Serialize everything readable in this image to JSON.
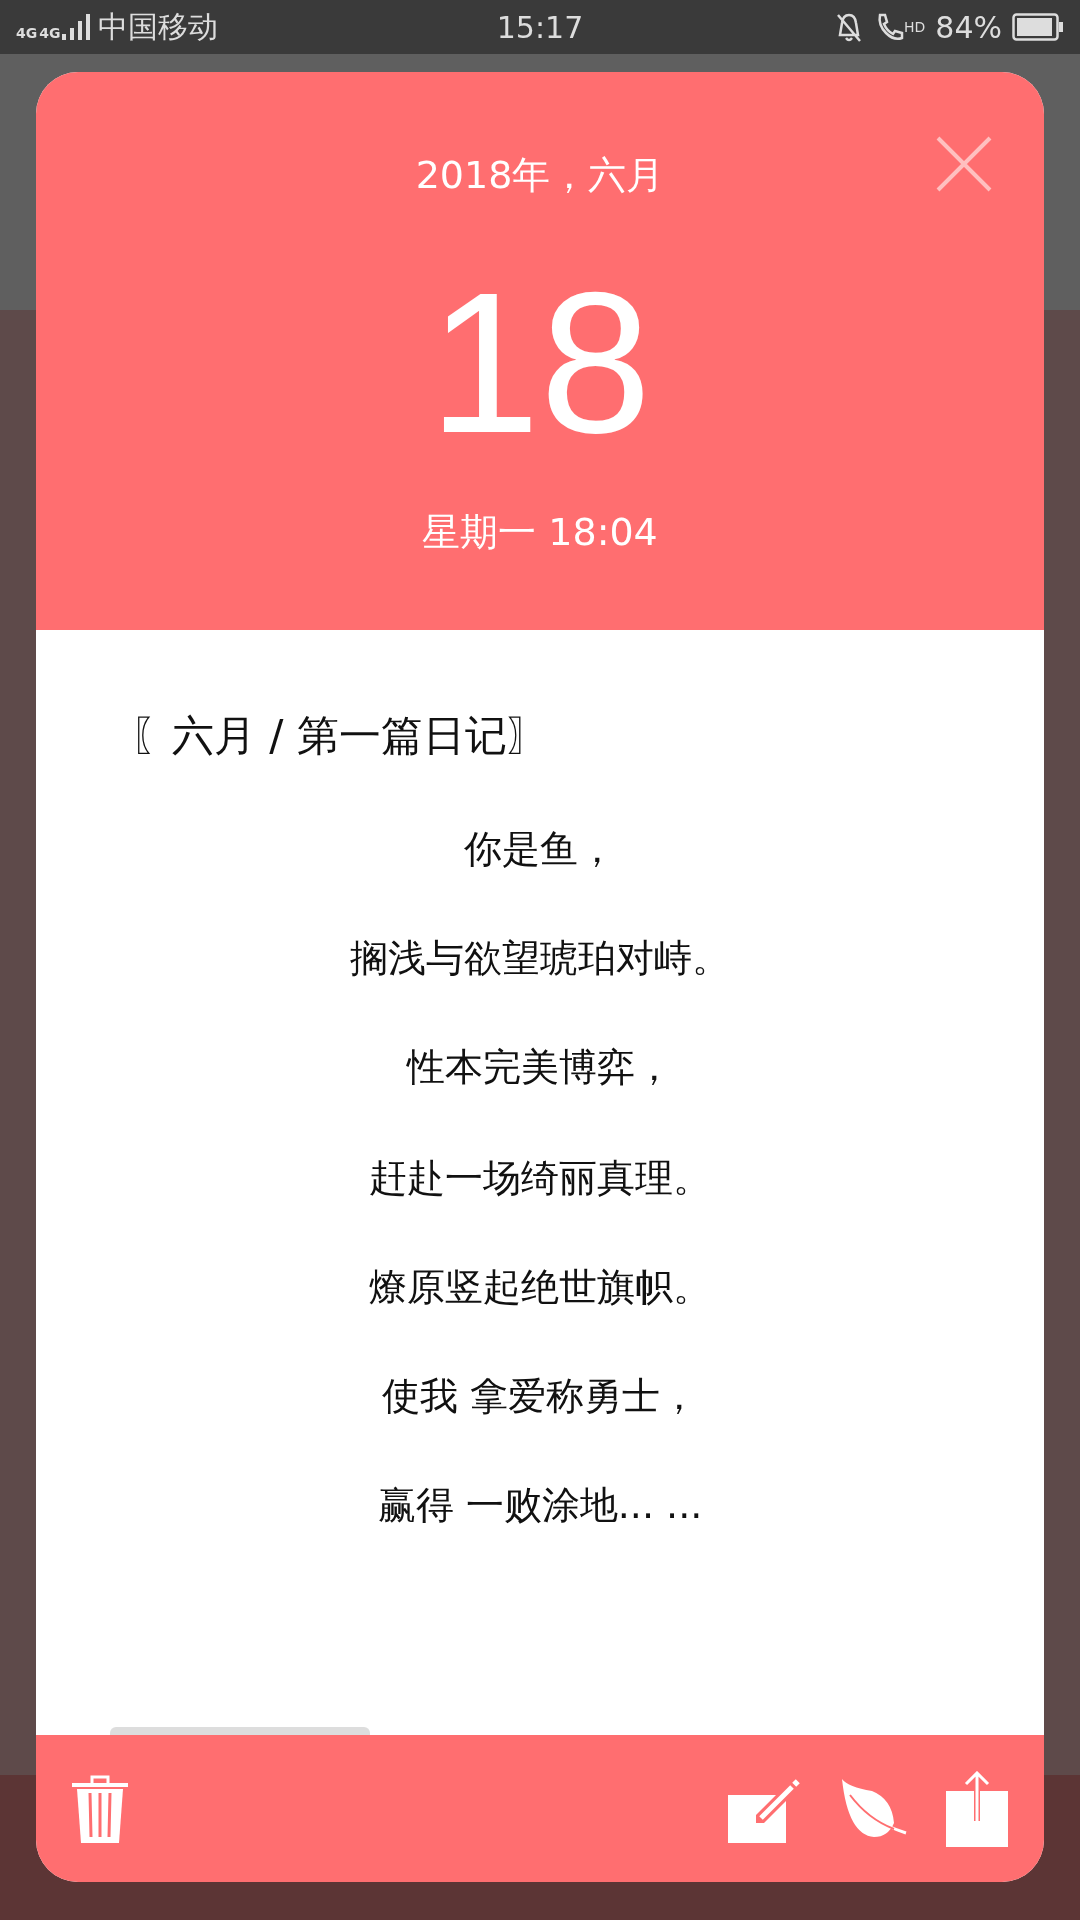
{
  "status_bar": {
    "network": [
      "4G",
      "4G"
    ],
    "carrier": "中国移动",
    "time": "15:17",
    "hd": "HD",
    "battery": "84%"
  },
  "header": {
    "year_month": "2018年，六月",
    "day": "18",
    "weekday_time": "星期一 18:04"
  },
  "entry": {
    "title": "〖六月 / 第一篇日记〗",
    "stanzas": [
      [
        "你是鱼，",
        "搁浅与欲望琥珀对峙。",
        "性本完美博弈，"
      ],
      [
        "赶赴一场绮丽真理。",
        "燎原竖起绝世旗帜。",
        "使我 拿爱称勇士，",
        "赢得 一败涂地... ..."
      ]
    ]
  }
}
